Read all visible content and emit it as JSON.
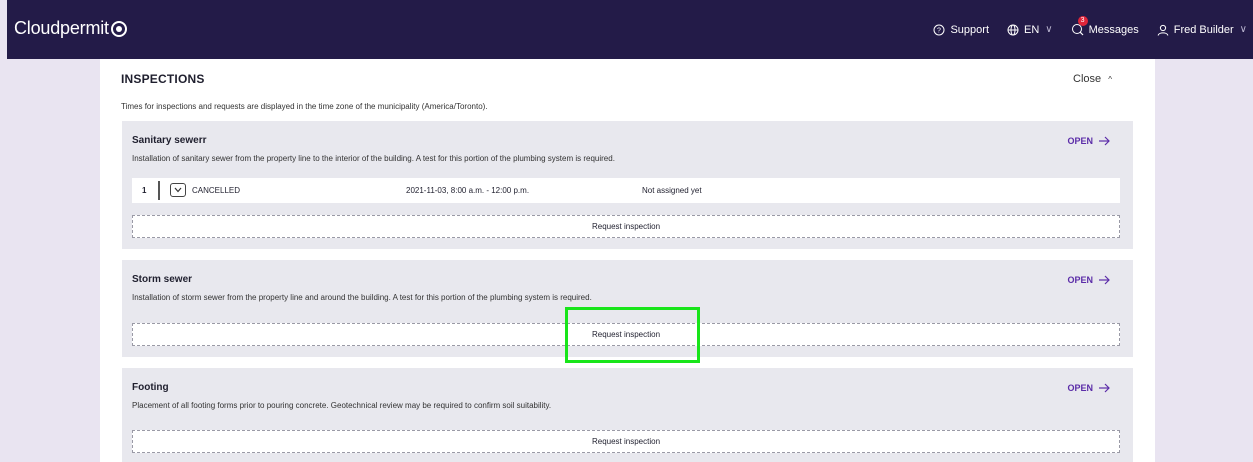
{
  "header": {
    "brand": "Cloudpermit",
    "support_label": "Support",
    "language_label": "EN",
    "messages_label": "Messages",
    "messages_count": "3",
    "user_label": "Fred Builder"
  },
  "panel": {
    "title": "INSPECTIONS",
    "close_label": "Close",
    "timezone_note": "Times for inspections and requests are displayed in the time zone of the municipality (America/Toronto)."
  },
  "sections": [
    {
      "title": "Sanitary sewerr",
      "description": "Installation of sanitary sewer from the property line to the interior of the building. A test for this portion of the plumbing system is required.",
      "open_label": "OPEN",
      "request_label": "Request inspection",
      "inspections": [
        {
          "number": "1",
          "status": "CANCELLED",
          "date": "2021-11-03, 8:00 a.m. - 12:00 p.m.",
          "assignee": "Not assigned yet"
        }
      ]
    },
    {
      "title": "Storm sewer",
      "description": "Installation of storm sewer from the property line and around the building. A test for this portion of the plumbing system is required.",
      "open_label": "OPEN",
      "request_label": "Request inspection"
    },
    {
      "title": "Footing",
      "description": "Placement of all footing forms prior to pouring concrete. Geotechnical review may be required to confirm soil suitability.",
      "open_label": "OPEN",
      "request_label": "Request inspection"
    }
  ],
  "colors": {
    "header_bg": "#231b48",
    "page_bg": "#e9e4f1",
    "accent": "#5b2ca8",
    "highlight": "#18e51a",
    "badge": "#e0253a"
  }
}
